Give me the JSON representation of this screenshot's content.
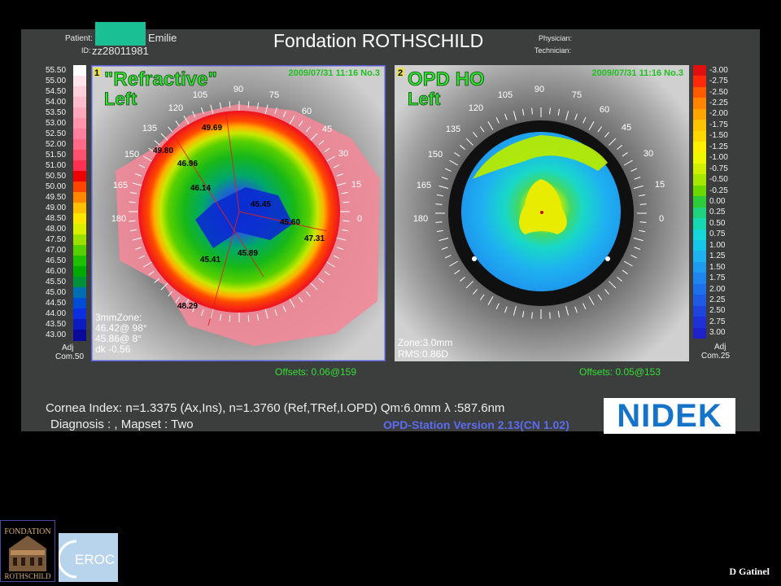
{
  "header": {
    "patient_label": "Patient:",
    "patient_name": "Emilie",
    "id_label": "ID:",
    "id_value": "zz28011981",
    "title": "Fondation ROTHSCHILD",
    "physician_label": "Physician:",
    "technician_label": "Technician:"
  },
  "left_scale": {
    "values": [
      "55.50",
      "55.00",
      "54.50",
      "54.00",
      "53.50",
      "53.00",
      "52.50",
      "52.00",
      "51.50",
      "51.00",
      "50.50",
      "50.00",
      "49.50",
      "49.00",
      "48.50",
      "48.00",
      "47.50",
      "47.00",
      "46.50",
      "46.00",
      "45.50",
      "45.00",
      "44.50",
      "44.00",
      "43.50",
      "43.00"
    ],
    "colors": [
      "#ffffff",
      "#ffe4ec",
      "#ffd0dc",
      "#ffbccc",
      "#ffa8bc",
      "#ff94ac",
      "#ff7f9c",
      "#ff6a88",
      "#ff5070",
      "#ff3050",
      "#ee0000",
      "#ff4400",
      "#ff8800",
      "#ffc000",
      "#ffe600",
      "#d8f000",
      "#9ce000",
      "#56d000",
      "#1cc000",
      "#00a800",
      "#008f3a",
      "#006db0",
      "#004cd6",
      "#0a2ee0",
      "#0a1cc0",
      "#0a0a9a"
    ],
    "footer1": "Adj",
    "footer2": "Com.50"
  },
  "right_scale": {
    "values": [
      "-3.00",
      "-2.75",
      "-2.50",
      "-2.25",
      "-2.00",
      "-1.75",
      "-1.50",
      "-1.25",
      "-1.00",
      "-0.75",
      "-0.50",
      "-0.25",
      "0.00",
      "0.25",
      "0.50",
      "0.75",
      "1.00",
      "1.25",
      "1.50",
      "1.75",
      "2.00",
      "2.25",
      "2.50",
      "2.75",
      "3.00"
    ],
    "colors": [
      "#e01010",
      "#ff2a0a",
      "#ff5a00",
      "#ff8400",
      "#ffa400",
      "#ffc400",
      "#ffd800",
      "#fff000",
      "#eef800",
      "#cff000",
      "#a6e800",
      "#6cd800",
      "#2ecc3a",
      "#20d27e",
      "#18d8b2",
      "#14d8d8",
      "#18c6e8",
      "#1eb2f0",
      "#1e9cf0",
      "#1e86ee",
      "#1e70ea",
      "#1e5ae4",
      "#1e44de",
      "#1e30d8",
      "#1e20c8"
    ],
    "footer1": "Adj",
    "footer2": "Com.25"
  },
  "map_left": {
    "number": "1",
    "title": "\"Refractive\"",
    "eye": "Left",
    "datetime": "2009/07/31 11:16 No.3",
    "angles": [
      "90",
      "75",
      "60",
      "45",
      "30",
      "15",
      "0",
      "105",
      "120",
      "135",
      "150",
      "165",
      "180"
    ],
    "point_values": [
      "49.69",
      "49.80",
      "46.96",
      "46.14",
      "45.45",
      "45.60",
      "47.31",
      "45.89",
      "45.41",
      "48.29"
    ],
    "zone_title": "3mmZone:",
    "zone_line1": "46.42@ 98°",
    "zone_line2": "45.86@ 8°",
    "zone_line3": "dk -0.56",
    "offsets": "Offsets: 0.06@159"
  },
  "map_right": {
    "number": "2",
    "title": "OPD HO",
    "eye": "Left",
    "datetime": "2009/07/31 11:16 No.3",
    "angles": [
      "90",
      "75",
      "60",
      "45",
      "30",
      "15",
      "0",
      "105",
      "120",
      "135",
      "150",
      "165",
      "180"
    ],
    "zone_text": "Zone:3.0mm",
    "rms_text": "RMS:0.86D",
    "offsets": "Offsets: 0.05@153"
  },
  "bottom": {
    "cornea_index": "Cornea Index: n=1.3375 (Ax,Ins), n=1.3760 (Ref,TRef,I.OPD)  Qm:6.0mm  λ :587.6nm",
    "diagnosis": "Diagnosis : , Mapset : Two",
    "version": "OPD-Station Version 2.13(CN 1.02)",
    "brand": "NIDEK"
  },
  "logos": {
    "fondation_top": "FONDATION",
    "fondation_bottom": "ROTHSCHILD",
    "ceroc": "EROC"
  },
  "credit": "D Gatinel"
}
